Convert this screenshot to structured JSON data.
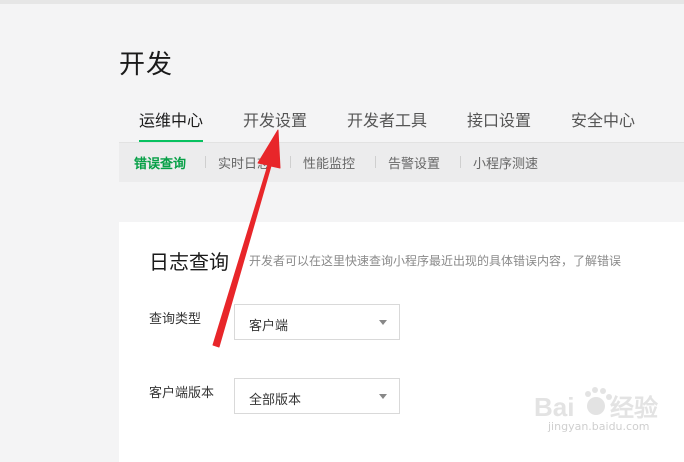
{
  "page": {
    "title": "开发"
  },
  "tabs": [
    {
      "label": "运维中心",
      "active": true
    },
    {
      "label": "开发设置",
      "active": false
    },
    {
      "label": "开发者工具",
      "active": false
    },
    {
      "label": "接口设置",
      "active": false
    },
    {
      "label": "安全中心",
      "active": false
    }
  ],
  "subtabs": [
    {
      "label": "错误查询",
      "active": true
    },
    {
      "label": "实时日志",
      "active": false
    },
    {
      "label": "性能监控",
      "active": false
    },
    {
      "label": "告警设置",
      "active": false
    },
    {
      "label": "小程序测速",
      "active": false
    }
  ],
  "card": {
    "title": "日志查询",
    "description": "开发者可以在这里快速查询小程序最近出现的具体错误内容，了解错误"
  },
  "fields": [
    {
      "label": "查询类型",
      "value": "客户端"
    },
    {
      "label": "客户端版本",
      "value": "全部版本"
    }
  ],
  "annotation": {
    "color": "#e8262a"
  },
  "watermark": {
    "text": "jingyan.baidu.com"
  }
}
